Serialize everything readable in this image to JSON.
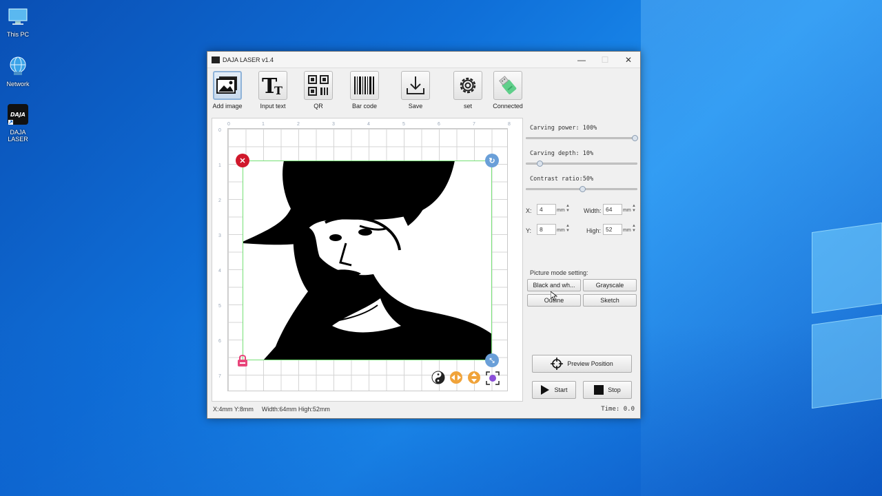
{
  "desktop": {
    "icons": [
      {
        "label": "This PC"
      },
      {
        "label": "Network"
      },
      {
        "label": "DAJA LASER"
      }
    ]
  },
  "window": {
    "title": "DAJA LASER v1.4",
    "controls": {
      "minimize": "—",
      "maximize": "☐",
      "close": "✕"
    }
  },
  "toolbar": {
    "add_image": "Add image",
    "input_text": "Input text",
    "qr": "QR",
    "bar_code": "Bar code",
    "save": "Save",
    "set": "set",
    "connected": "Connected"
  },
  "canvas": {
    "ruler_x": [
      "0",
      "1",
      "2",
      "3",
      "4",
      "5",
      "6",
      "7",
      "8"
    ],
    "ruler_y": [
      "0",
      "1",
      "2",
      "3",
      "4",
      "5",
      "6",
      "7"
    ]
  },
  "status": {
    "position": "X:4mm Y:8mm",
    "size": "Width:64mm High:52mm",
    "time": "Time: 0.0"
  },
  "settings": {
    "carving_power": {
      "label": "Carving power: 100%",
      "value": 100
    },
    "carving_depth": {
      "label": "Carving depth: 10%",
      "value": 10
    },
    "contrast_ratio": {
      "label": "Contrast ratio:50%",
      "value": 50
    },
    "x": {
      "label": "X:",
      "value": "4",
      "unit": "mm"
    },
    "y": {
      "label": "Y:",
      "value": "8",
      "unit": "mm"
    },
    "width": {
      "label": "Width:",
      "value": "64",
      "unit": "mm"
    },
    "high": {
      "label": "High:",
      "value": "52",
      "unit": "mm"
    }
  },
  "picture_mode": {
    "title": "Picture mode setting:",
    "black_white": "Black and wh...",
    "grayscale": "Grayscale",
    "outline": "Outline",
    "sketch": "Sketch"
  },
  "actions": {
    "preview_position": "Preview Position",
    "start": "Start",
    "stop": "Stop"
  },
  "colors": {
    "delete_handle": "#d0182b",
    "rotate_handle": "#6a9fd8",
    "lock_handle": "#e8457a",
    "selection_border": "#74e074"
  }
}
